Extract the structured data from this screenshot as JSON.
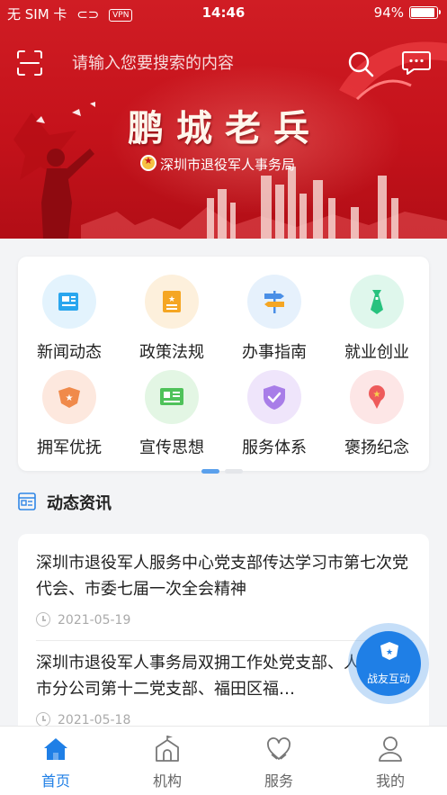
{
  "status_bar": {
    "carrier": "无 SIM 卡",
    "vpn": "VPN",
    "time": "14:46",
    "battery": "94%"
  },
  "header": {
    "search_placeholder": "请输入您要搜索的内容"
  },
  "banner": {
    "title": "鹏城老兵",
    "subtitle": "深圳市退役军人事务局"
  },
  "menu": {
    "items": [
      {
        "label": "新闻动态",
        "icon": "news-icon",
        "bg": "#e3f3fd",
        "color": "#2aa6ee"
      },
      {
        "label": "政策法规",
        "icon": "policy-icon",
        "bg": "#fdf0dc",
        "color": "#f5a623"
      },
      {
        "label": "办事指南",
        "icon": "guide-icon",
        "bg": "#e6f1fc",
        "color": "#4a8fe6"
      },
      {
        "label": "就业创业",
        "icon": "employment-icon",
        "bg": "#dff7ec",
        "color": "#27c27e"
      },
      {
        "label": "拥军优抚",
        "icon": "medal-icon",
        "bg": "#fde8de",
        "color": "#f08a4b"
      },
      {
        "label": "宣传思想",
        "icon": "propaganda-icon",
        "bg": "#e3f6e4",
        "color": "#4fc25a"
      },
      {
        "label": "服务体系",
        "icon": "service-shield-icon",
        "bg": "#efe5fb",
        "color": "#a87de8"
      },
      {
        "label": "褒扬纪念",
        "icon": "commemorate-icon",
        "bg": "#fde6e6",
        "color": "#ee5b5b"
      }
    ],
    "page_count": 2,
    "active_page": 1
  },
  "section": {
    "title": "动态资讯"
  },
  "news": [
    {
      "title": "深圳市退役军人服务中心党支部传达学习市第七次党代会、市委七届一次全会精神",
      "date": "2021-05-19"
    },
    {
      "title": "深圳市退役军人事务局双拥工作处党支部、人寿深圳市分公司第十二党支部、福田区福…",
      "date": "2021-05-18"
    }
  ],
  "fab": {
    "label": "战友互动"
  },
  "tabs": [
    {
      "label": "首页",
      "icon": "home-icon",
      "active": true
    },
    {
      "label": "机构",
      "icon": "institution-icon",
      "active": false
    },
    {
      "label": "服务",
      "icon": "service-icon",
      "active": false
    },
    {
      "label": "我的",
      "icon": "profile-icon",
      "active": false
    }
  ],
  "colors": {
    "banner_red": "#c5121b",
    "accent_blue": "#1f7fe6",
    "inactive_gray": "#666666"
  }
}
